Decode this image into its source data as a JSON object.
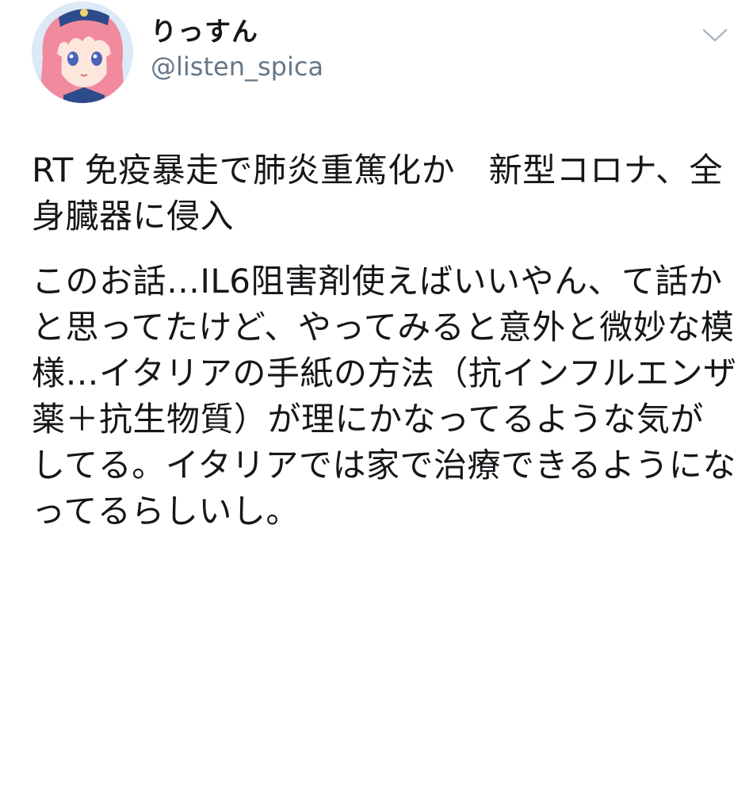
{
  "user": {
    "display_name": "りっすん",
    "handle": "@listen_spica",
    "avatar_icon": "avatar-icon"
  },
  "menu": {
    "icon": "chevron-down-icon"
  },
  "tweet": {
    "paragraph_1": "RT 免疫暴走で肺炎重篤化か　新型コロナ、全身臓器に侵入",
    "paragraph_2": "このお話…IL6阻害剤使えばいいやん、て話かと思ってたけど、やってみると意外と微妙な模様…イタリアの手紙の方法（抗インフルエンザ薬＋抗生物質）が理にかなってるような気がしてる。イタリアでは家で治療できるようになってるらしいし。"
  },
  "colors": {
    "text": "#14171a",
    "secondary": "#657786",
    "chevron": "#aab8c2",
    "avatar_hair": "#f08a9c",
    "avatar_bg": "#dce9f7"
  }
}
